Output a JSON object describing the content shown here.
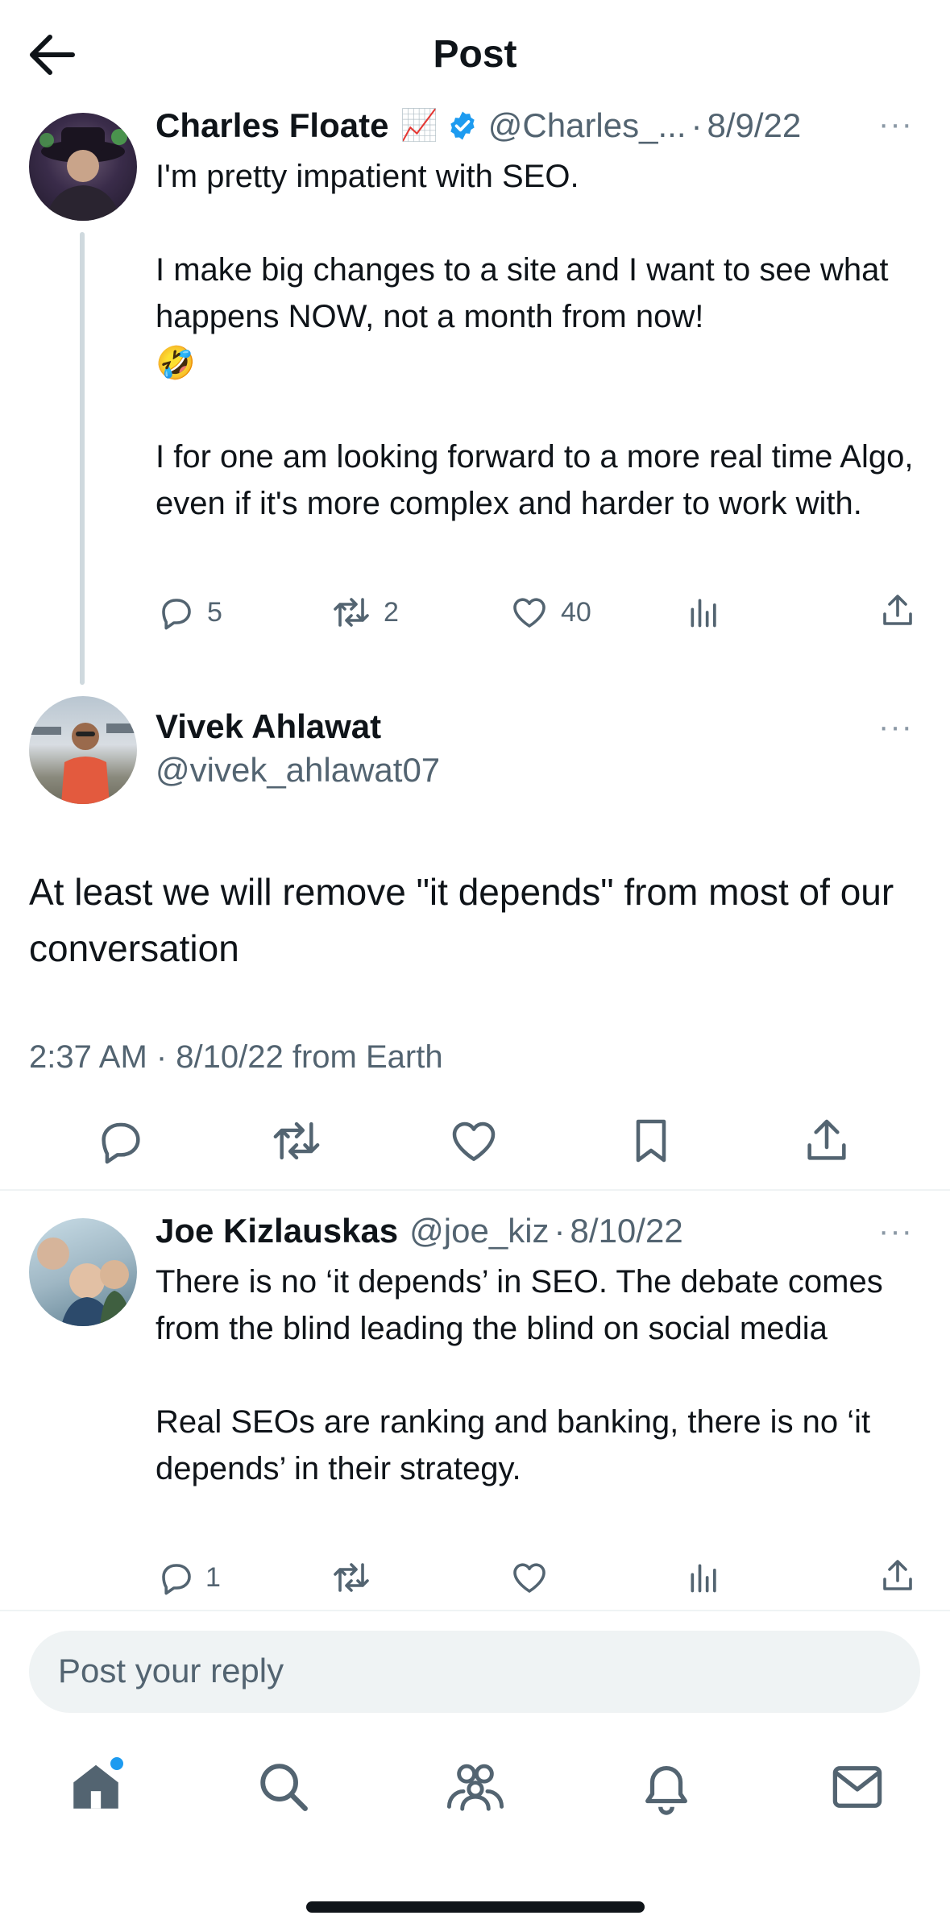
{
  "header": {
    "title": "Post",
    "back_icon": "arrow-left-icon"
  },
  "parent_post": {
    "author_name": "Charles Floate",
    "emoji": "📈",
    "verified_icon": "verified-badge-icon",
    "handle": "@Charles_...",
    "date": "8/9/22",
    "text": "I'm pretty impatient with SEO.\n\nI make big changes to a site and I want to see what happens NOW, not a month from now!\n🤣\n\nI for one am looking forward to a more real time Algo, even if it's more complex and harder to work with.",
    "replies": "5",
    "reposts": "2",
    "likes": "40"
  },
  "main_post": {
    "author_name": "Vivek Ahlawat",
    "handle": "@vivek_ahlawat07",
    "text": "At least we will remove \"it depends\" from most of our conversation",
    "timestamp": "2:37 AM · 8/10/22 from Earth"
  },
  "reply_post": {
    "author_name": "Joe Kizlauskas",
    "handle": "@joe_kiz",
    "date": "8/10/22",
    "text": "There is no ‘it depends’ in SEO. The debate comes from the blind leading the blind on social media\n\nReal SEOs are ranking and banking, there is no ‘it depends’ in their strategy.",
    "replies": "1"
  },
  "reply_input": {
    "placeholder": "Post your reply"
  },
  "more_dots": "···",
  "separator": "·",
  "bottom_nav": [
    "home-icon",
    "search-icon",
    "communities-icon",
    "notifications-icon",
    "messages-icon"
  ],
  "colors": {
    "accent": "#1d9bf0",
    "text": "#0f1419",
    "muted": "#536471",
    "divider": "#eff3f4"
  }
}
